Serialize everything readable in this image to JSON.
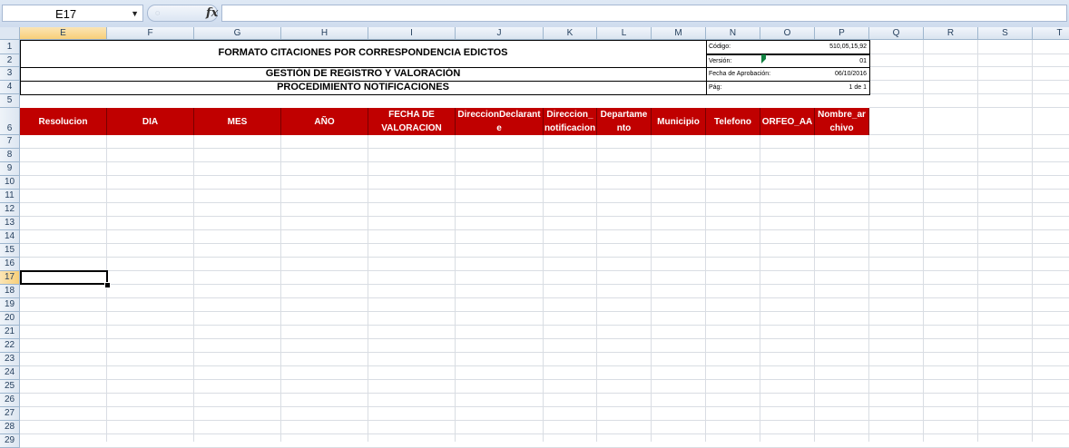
{
  "formula_bar": {
    "name_box": "E17",
    "formula": ""
  },
  "columns": [
    "E",
    "F",
    "G",
    "H",
    "I",
    "J",
    "K",
    "L",
    "M",
    "N",
    "O",
    "P",
    "Q",
    "R",
    "S",
    "T"
  ],
  "selected_column": "E",
  "rows": [
    "1",
    "2",
    "3",
    "4",
    "5",
    "6",
    "7",
    "8",
    "9",
    "10",
    "11",
    "12",
    "13",
    "14",
    "15",
    "16",
    "17",
    "18",
    "19",
    "20",
    "21",
    "22",
    "23",
    "24",
    "25",
    "26",
    "27",
    "28",
    "29"
  ],
  "selected_row": "17",
  "sheet": {
    "title": "FORMATO CITACIONES POR CORRESPONDENCIA EDICTOS",
    "subtitle1": "GESTIÓN DE REGISTRO Y VALORACIÓN",
    "subtitle2": "PROCEDIMIENTO NOTIFICACIONES",
    "meta": [
      {
        "label": "Código:",
        "value": "510,05,15,92"
      },
      {
        "label": "Versión:",
        "value": "01"
      },
      {
        "label": "Fecha de Aprobación:",
        "value": "06/10/2016"
      },
      {
        "label": "Pág:",
        "value": "1 de 1"
      }
    ],
    "headers": [
      [
        "Resolucion"
      ],
      [
        "DIA"
      ],
      [
        "MES"
      ],
      [
        "AÑO"
      ],
      [
        "FECHA DE",
        "VALORACION"
      ],
      [
        "DireccionDeclarant",
        "e"
      ],
      [
        "Direccion_",
        "notificacion"
      ],
      [
        "Departame",
        "nto"
      ],
      [
        "Municipio"
      ],
      [
        "Telefono"
      ],
      [
        "ORFEO_AA"
      ],
      [
        "Nombre_ar",
        "chivo"
      ]
    ],
    "header_color": "#c00000"
  }
}
